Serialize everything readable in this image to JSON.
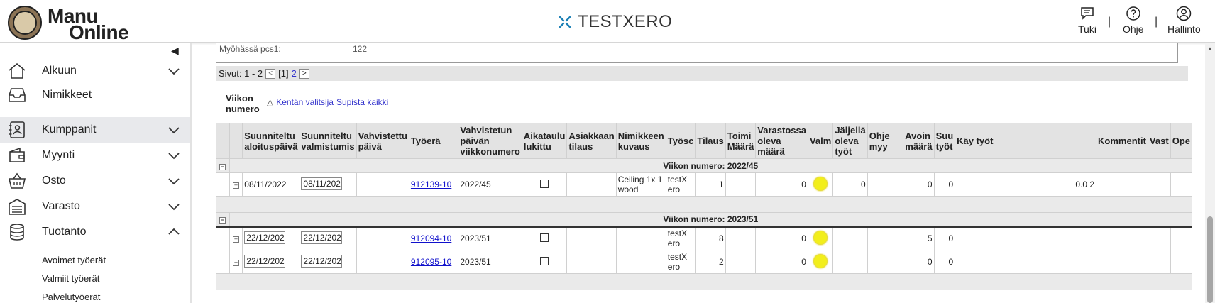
{
  "header": {
    "logo_line1": "Manu",
    "logo_line2": "Online",
    "company": "TESTXERO",
    "support_label": "Tuki",
    "help_label": "Ohje",
    "admin_label": "Hallinto",
    "separator": "|"
  },
  "sidebar": {
    "items": [
      {
        "label": "Alkuun",
        "icon": "home-icon"
      },
      {
        "label": "Nimikkeet",
        "icon": "inbox-icon"
      },
      {
        "label": "Kumppanit",
        "icon": "contacts-icon"
      },
      {
        "label": "Myynti",
        "icon": "wallet-icon"
      },
      {
        "label": "Osto",
        "icon": "basket-icon"
      },
      {
        "label": "Varasto",
        "icon": "warehouse-icon"
      },
      {
        "label": "Tuotanto",
        "icon": "database-icon"
      }
    ],
    "subitems": [
      "Avoimet työerät",
      "Valmiit työerät",
      "Palvelutyöerät"
    ]
  },
  "summary": {
    "label": "Myöhässä pcs1:",
    "value": "122"
  },
  "pager": {
    "label": "Sivut: 1 - 2",
    "current": "[1]",
    "next_page": "2"
  },
  "grouping": {
    "title": "Viikon numero",
    "selector_link": "Kentän valitsija",
    "collapse_link": "Supista kaikki"
  },
  "table": {
    "columns": [
      "Suunniteltu aloituspäivä",
      "Suunniteltu valmistumis",
      "Vahvistettu päivä",
      "Työerä",
      "Vahvistetun päivän viikkonumero",
      "Aikataulu lukittu",
      "Asiakkaan tilaus",
      "Nimikkeen kuvaus",
      "Työsc",
      "Tilaus",
      "Toimi Määrä",
      "Varastossa oleva määrä",
      "Valm",
      "Jäljellä oleva työt",
      "Ohje myy",
      "Avoin määrä",
      "Suu työt",
      "Käy työt",
      "Kommentit",
      "Vast",
      "Ope"
    ],
    "groups": [
      {
        "label": "Viikon numero: 2022/45",
        "rows": [
          {
            "start": "08/11/2022",
            "end": "08/11/2022",
            "confirmed": "",
            "batch": "912139-10",
            "week": "2022/45",
            "desc": "Ceiling 1x 1 wood",
            "work": "testX ero",
            "order": "1",
            "delivered": "",
            "stock": "0",
            "remaining": "0",
            "instr": "",
            "open": "0",
            "planned": "0",
            "used": "0.0 2",
            "comment": ""
          }
        ]
      },
      {
        "label": "Viikon numero: 2023/51",
        "rows": [
          {
            "start": "22/12/2023",
            "end": "22/12/2023",
            "confirmed": "",
            "batch": "912094-10",
            "week": "2023/51",
            "desc": "",
            "work": "testX ero",
            "order": "8",
            "delivered": "",
            "stock": "0",
            "remaining": "",
            "instr": "",
            "open": "5",
            "planned": "0",
            "used": "",
            "comment": ""
          },
          {
            "start": "22/12/2023",
            "end": "22/12/2023",
            "confirmed": "",
            "batch": "912095-10",
            "week": "2023/51",
            "desc": "",
            "work": "testX ero",
            "order": "2",
            "delivered": "",
            "stock": "0",
            "remaining": "",
            "instr": "",
            "open": "0",
            "planned": "0",
            "used": "",
            "comment": ""
          }
        ]
      }
    ]
  },
  "colors": {
    "accent": "#1a7fb5",
    "status_yellow": "#f2ee1b",
    "link": "#1111cc"
  }
}
